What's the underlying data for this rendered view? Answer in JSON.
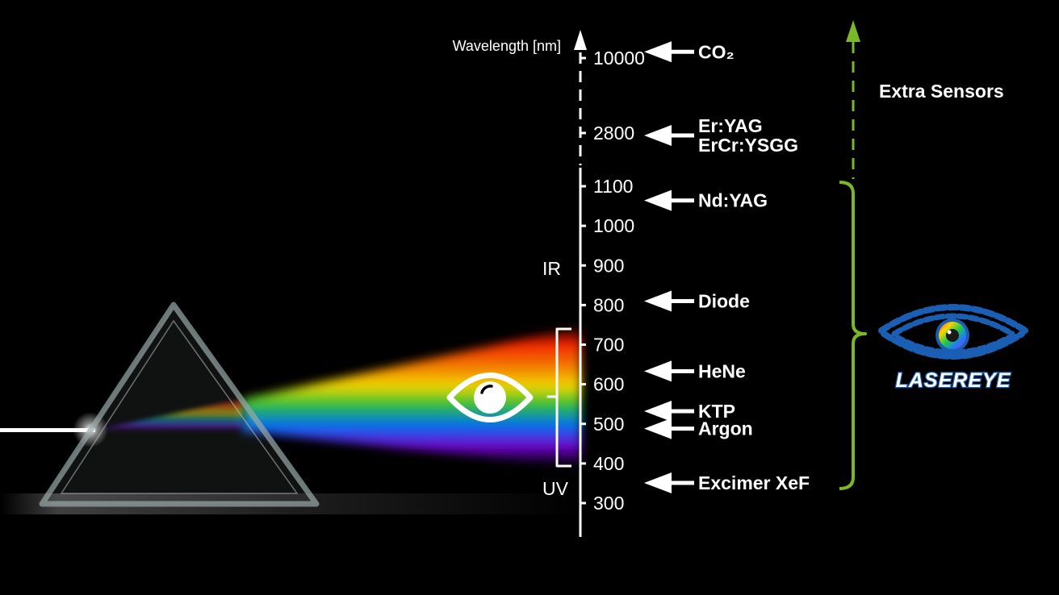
{
  "axis": {
    "title": "Wavelength [nm]",
    "ticks": [
      {
        "label": "10000",
        "value": 10000
      },
      {
        "label": "2800",
        "value": 2800
      },
      {
        "label": "1100",
        "value": 1100
      },
      {
        "label": "1000",
        "value": 1000
      },
      {
        "label": "900",
        "value": 900
      },
      {
        "label": "800",
        "value": 800
      },
      {
        "label": "700",
        "value": 700
      },
      {
        "label": "600",
        "value": 600
      },
      {
        "label": "500",
        "value": 500
      },
      {
        "label": "400",
        "value": 400
      },
      {
        "label": "300",
        "value": 300
      }
    ]
  },
  "regions": {
    "ir": "IR",
    "uv": "UV"
  },
  "lasers": [
    {
      "name": "CO₂",
      "wavelength_nm": 10600
    },
    {
      "name": "Er:YAG",
      "wavelength_nm": 2940
    },
    {
      "name": "ErCr:YSGG",
      "wavelength_nm": 2780
    },
    {
      "name": "Nd:YAG",
      "wavelength_nm": 1064
    },
    {
      "name": "Diode",
      "wavelength_nm": 810
    },
    {
      "name": "HeNe",
      "wavelength_nm": 633
    },
    {
      "name": "KTP",
      "wavelength_nm": 532
    },
    {
      "name": "Argon",
      "wavelength_nm": 488
    },
    {
      "name": "Excimer XeF",
      "wavelength_nm": 351
    }
  ],
  "visible_range": {
    "from_nm": 400,
    "to_nm": 740
  },
  "sensor_range": {
    "from_nm": 350,
    "to_nm": 1100
  },
  "extra_sensors": {
    "label": "Extra Sensors"
  },
  "logo": {
    "text": "LASEREYE"
  },
  "icons": {
    "eye": "eye-icon",
    "logo": "lasereye-logo-icon"
  },
  "colors": {
    "background": "#000000",
    "axis": "#ffffff",
    "sensor_bracket": "#7ab82a",
    "logo_blue": "#1a5fb4"
  }
}
